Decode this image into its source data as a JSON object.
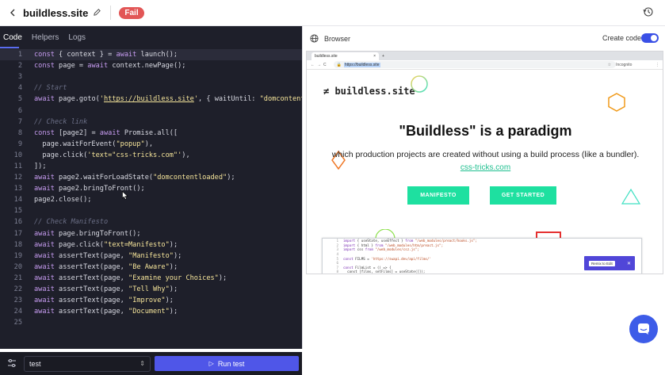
{
  "header": {
    "title": "buildless.site",
    "status_badge": "Fail"
  },
  "editor": {
    "tabs": [
      {
        "label": "Code"
      },
      {
        "label": "Helpers"
      },
      {
        "label": "Logs"
      }
    ],
    "lines": [
      {
        "n": "1",
        "parts": [
          [
            "kw",
            "const"
          ],
          [
            "txt",
            " { context } = "
          ],
          [
            "kw",
            "await"
          ],
          [
            "txt",
            " launch();"
          ]
        ],
        "hl": true
      },
      {
        "n": "2",
        "parts": [
          [
            "kw",
            "const"
          ],
          [
            "txt",
            " page = "
          ],
          [
            "kw",
            "await"
          ],
          [
            "txt",
            " context.newPage();"
          ]
        ]
      },
      {
        "n": "3",
        "parts": []
      },
      {
        "n": "4",
        "parts": [
          [
            "cmt",
            "// Start"
          ]
        ]
      },
      {
        "n": "5",
        "parts": [
          [
            "kw",
            "await"
          ],
          [
            "txt",
            " page.goto("
          ],
          [
            "str",
            "'"
          ],
          [
            "strurl",
            "https://buildless.site"
          ],
          [
            "str",
            "'"
          ],
          [
            "txt",
            ", { waitUntil: "
          ],
          [
            "str",
            "\"domcontentlo"
          ]
        ]
      },
      {
        "n": "6",
        "parts": []
      },
      {
        "n": "7",
        "parts": [
          [
            "cmt",
            "// Check link"
          ]
        ]
      },
      {
        "n": "8",
        "parts": [
          [
            "kw",
            "const"
          ],
          [
            "txt",
            " [page2] = "
          ],
          [
            "kw",
            "await"
          ],
          [
            "txt",
            " Promise.all(["
          ]
        ]
      },
      {
        "n": "9",
        "parts": [
          [
            "txt",
            "  page.waitForEvent("
          ],
          [
            "str",
            "\"popup\""
          ],
          [
            "txt",
            "),"
          ]
        ]
      },
      {
        "n": "10",
        "parts": [
          [
            "txt",
            "  page.click("
          ],
          [
            "str",
            "'text=\"css-tricks.com\"'"
          ],
          [
            "txt",
            "),"
          ]
        ]
      },
      {
        "n": "11",
        "parts": [
          [
            "txt",
            "]);"
          ]
        ]
      },
      {
        "n": "12",
        "parts": [
          [
            "kw",
            "await"
          ],
          [
            "txt",
            " page2.waitForLoadState("
          ],
          [
            "str",
            "\"domcontentloaded\""
          ],
          [
            "txt",
            ");"
          ]
        ]
      },
      {
        "n": "13",
        "parts": [
          [
            "kw",
            "await"
          ],
          [
            "txt",
            " page2.bringToFront();"
          ]
        ]
      },
      {
        "n": "14",
        "parts": [
          [
            "txt",
            "page2.close();"
          ]
        ]
      },
      {
        "n": "15",
        "parts": []
      },
      {
        "n": "16",
        "parts": [
          [
            "cmt",
            "// Check Manifesto"
          ]
        ]
      },
      {
        "n": "17",
        "parts": [
          [
            "kw",
            "await"
          ],
          [
            "txt",
            " page.bringToFront();"
          ]
        ]
      },
      {
        "n": "18",
        "parts": [
          [
            "kw",
            "await"
          ],
          [
            "txt",
            " page.click("
          ],
          [
            "str",
            "\"text=Manifesto\""
          ],
          [
            "txt",
            ");"
          ]
        ]
      },
      {
        "n": "19",
        "parts": [
          [
            "kw",
            "await"
          ],
          [
            "txt",
            " assertText(page, "
          ],
          [
            "str",
            "\"Manifesto\""
          ],
          [
            "txt",
            ");"
          ]
        ]
      },
      {
        "n": "20",
        "parts": [
          [
            "kw",
            "await"
          ],
          [
            "txt",
            " assertText(page, "
          ],
          [
            "str",
            "\"Be Aware\""
          ],
          [
            "txt",
            ");"
          ]
        ]
      },
      {
        "n": "21",
        "parts": [
          [
            "kw",
            "await"
          ],
          [
            "txt",
            " assertText(page, "
          ],
          [
            "str",
            "\"Examine your Choices\""
          ],
          [
            "txt",
            ");"
          ]
        ]
      },
      {
        "n": "22",
        "parts": [
          [
            "kw",
            "await"
          ],
          [
            "txt",
            " assertText(page, "
          ],
          [
            "str",
            "\"Tell Why\""
          ],
          [
            "txt",
            ");"
          ]
        ]
      },
      {
        "n": "23",
        "parts": [
          [
            "kw",
            "await"
          ],
          [
            "txt",
            " assertText(page, "
          ],
          [
            "str",
            "\"Improve\""
          ],
          [
            "txt",
            ");"
          ]
        ]
      },
      {
        "n": "24",
        "parts": [
          [
            "kw",
            "await"
          ],
          [
            "txt",
            " assertText(page, "
          ],
          [
            "str",
            "\"Document\""
          ],
          [
            "txt",
            ");"
          ]
        ]
      },
      {
        "n": "25",
        "parts": []
      }
    ]
  },
  "footer": {
    "selected_test": "test",
    "run_label": "Run test"
  },
  "browser_panel": {
    "title": "Browser",
    "create_code_label": "Create code",
    "create_code_enabled": true,
    "tab_title": "buildless.site",
    "address": "https://buildless.site",
    "incognito_label": "Incognito",
    "site": {
      "logo": "≠ buildless.site",
      "headline": "\"Buildless\" is a paradigm",
      "subtitle": "which production projects are created without using a build process (like a bundler).",
      "link": "css-tricks.com",
      "button_manifesto": "MANIFESTO",
      "button_started": "GET STARTED",
      "remix_label": "Remix to Edit",
      "snippet_lines": [
        {
          "n": "1",
          "k": "import",
          "t": " { useState, useEffect } ",
          "k2": "from",
          "s": " \"/web_modules/preact/hooks.js\";"
        },
        {
          "n": "2",
          "k": "import",
          "t": " { html } ",
          "k2": "from",
          "s": " \"/web_modules/htm/preact.js\";"
        },
        {
          "n": "3",
          "k": "import",
          "t": " css ",
          "k2": "from",
          "s": " \"/web_modules/csz.js\";"
        },
        {
          "n": "4",
          "k": "",
          "t": "",
          "k2": "",
          "s": ""
        },
        {
          "n": "5",
          "k": "const",
          "t": " FILMS = ",
          "k2": "",
          "s": "'https://swapi.dev/api/films/'"
        },
        {
          "n": "6",
          "k": "",
          "t": "",
          "k2": "",
          "s": ""
        },
        {
          "n": "7",
          "k": "const",
          "t": " FilmList = () => {",
          "k2": "",
          "s": ""
        },
        {
          "n": "8",
          "k": "",
          "t": "  const [films, setFilms] = useState([]);",
          "k2": "",
          "s": ""
        }
      ]
    }
  },
  "colors": {
    "accent": "#4f56e8",
    "fail": "#e25656",
    "site_green": "#1ee0a0"
  }
}
